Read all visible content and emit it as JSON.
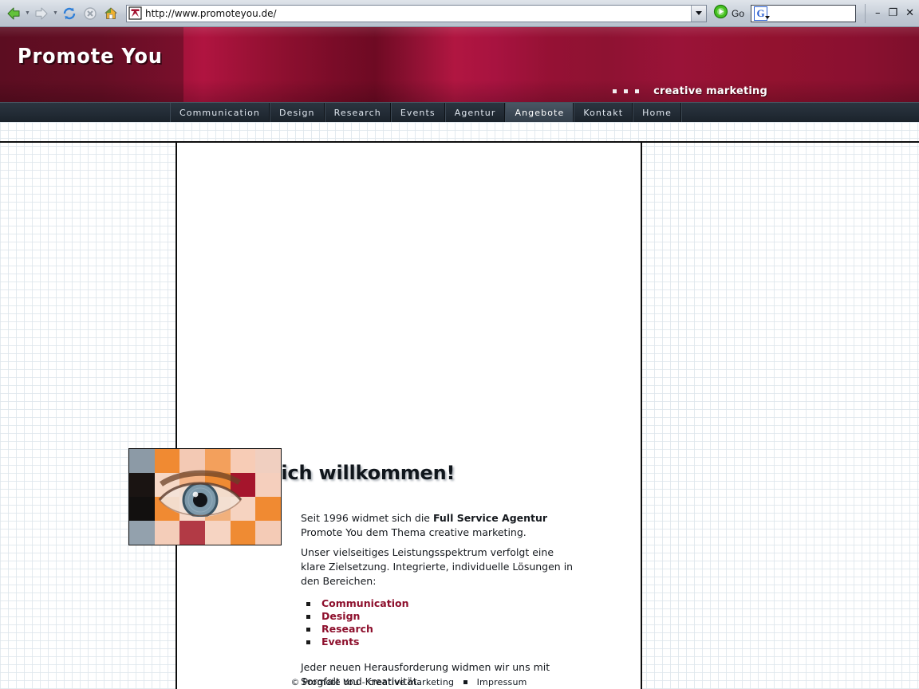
{
  "browser": {
    "toolbar": {
      "back_icon": "back-arrow-icon",
      "forward_icon": "forward-arrow-icon",
      "refresh_icon": "refresh-icon",
      "stop_icon": "stop-icon",
      "home_icon": "home-icon",
      "go_label": "Go",
      "go_icon": "go-play-icon",
      "search_icon": "google-g-icon",
      "search_value": "",
      "search_placeholder": ""
    },
    "address": {
      "url": "http://www.promoteyou.de/",
      "favicon": "site-favicon",
      "dropdown_icon": "chevron-down-icon"
    },
    "window_controls": {
      "minimize": "–",
      "restore": "❐",
      "close": "✕"
    }
  },
  "site": {
    "logo": "Promote You",
    "tagline": "creative marketing",
    "nav": [
      {
        "label": "Communication",
        "active": false
      },
      {
        "label": "Design",
        "active": false
      },
      {
        "label": "Research",
        "active": false
      },
      {
        "label": "Events",
        "active": false
      },
      {
        "label": "Agentur",
        "active": false
      },
      {
        "label": "Angebote",
        "active": true
      },
      {
        "label": "Kontakt",
        "active": false
      },
      {
        "label": "Home",
        "active": false
      }
    ],
    "main": {
      "heading": "Herzlich willkommen!",
      "paragraph_1_pre": "Seit 1996 widmet sich die ",
      "paragraph_1_bold": "Full Service Agentur",
      "paragraph_1_post": " Promote You dem Thema creative marketing.",
      "paragraph_2": "Unser vielseitiges Leistungsspektrum verfolgt eine klare Zielsetzung. Integrierte, individuelle Lösungen in den Bereichen:",
      "services": [
        "Communication",
        "Design",
        "Research",
        "Events"
      ],
      "paragraph_3": "Jeder neuen Herausforderung widmen wir uns mit Sorgfalt und Kreativität.",
      "image_alt": "eye-mosaic-image"
    },
    "footer": {
      "copyright": "© Promote You - creative marketing",
      "impressum": "Impressum"
    },
    "colors": {
      "banner_red": "#9f1238",
      "banner_dark_red": "#5d0d22",
      "nav_bar": "#232c36",
      "nav_active": "#3c4855",
      "link_red": "#8d0f2c",
      "page_grid": "#dee6ec"
    }
  }
}
